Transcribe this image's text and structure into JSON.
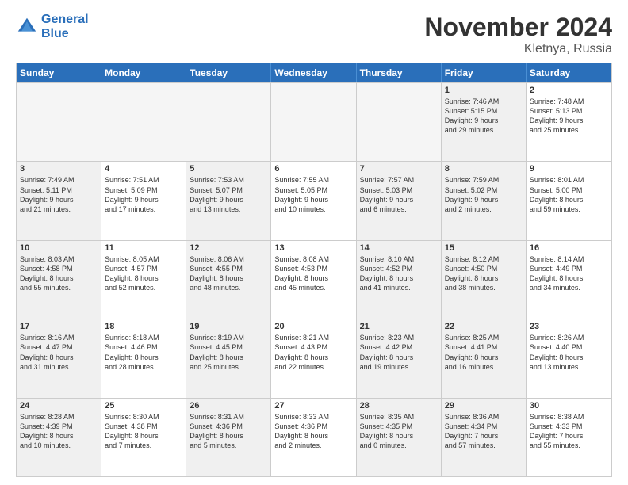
{
  "logo": {
    "line1": "General",
    "line2": "Blue"
  },
  "header": {
    "month": "November 2024",
    "location": "Kletnya, Russia"
  },
  "dayHeaders": [
    "Sunday",
    "Monday",
    "Tuesday",
    "Wednesday",
    "Thursday",
    "Friday",
    "Saturday"
  ],
  "weeks": [
    [
      {
        "day": "",
        "text": "",
        "empty": true
      },
      {
        "day": "",
        "text": "",
        "empty": true
      },
      {
        "day": "",
        "text": "",
        "empty": true
      },
      {
        "day": "",
        "text": "",
        "empty": true
      },
      {
        "day": "",
        "text": "",
        "empty": true
      },
      {
        "day": "1",
        "text": "Sunrise: 7:46 AM\nSunset: 5:15 PM\nDaylight: 9 hours\nand 29 minutes.",
        "shaded": true
      },
      {
        "day": "2",
        "text": "Sunrise: 7:48 AM\nSunset: 5:13 PM\nDaylight: 9 hours\nand 25 minutes."
      }
    ],
    [
      {
        "day": "3",
        "text": "Sunrise: 7:49 AM\nSunset: 5:11 PM\nDaylight: 9 hours\nand 21 minutes.",
        "shaded": true
      },
      {
        "day": "4",
        "text": "Sunrise: 7:51 AM\nSunset: 5:09 PM\nDaylight: 9 hours\nand 17 minutes."
      },
      {
        "day": "5",
        "text": "Sunrise: 7:53 AM\nSunset: 5:07 PM\nDaylight: 9 hours\nand 13 minutes.",
        "shaded": true
      },
      {
        "day": "6",
        "text": "Sunrise: 7:55 AM\nSunset: 5:05 PM\nDaylight: 9 hours\nand 10 minutes."
      },
      {
        "day": "7",
        "text": "Sunrise: 7:57 AM\nSunset: 5:03 PM\nDaylight: 9 hours\nand 6 minutes.",
        "shaded": true
      },
      {
        "day": "8",
        "text": "Sunrise: 7:59 AM\nSunset: 5:02 PM\nDaylight: 9 hours\nand 2 minutes.",
        "shaded": true
      },
      {
        "day": "9",
        "text": "Sunrise: 8:01 AM\nSunset: 5:00 PM\nDaylight: 8 hours\nand 59 minutes."
      }
    ],
    [
      {
        "day": "10",
        "text": "Sunrise: 8:03 AM\nSunset: 4:58 PM\nDaylight: 8 hours\nand 55 minutes.",
        "shaded": true
      },
      {
        "day": "11",
        "text": "Sunrise: 8:05 AM\nSunset: 4:57 PM\nDaylight: 8 hours\nand 52 minutes."
      },
      {
        "day": "12",
        "text": "Sunrise: 8:06 AM\nSunset: 4:55 PM\nDaylight: 8 hours\nand 48 minutes.",
        "shaded": true
      },
      {
        "day": "13",
        "text": "Sunrise: 8:08 AM\nSunset: 4:53 PM\nDaylight: 8 hours\nand 45 minutes."
      },
      {
        "day": "14",
        "text": "Sunrise: 8:10 AM\nSunset: 4:52 PM\nDaylight: 8 hours\nand 41 minutes.",
        "shaded": true
      },
      {
        "day": "15",
        "text": "Sunrise: 8:12 AM\nSunset: 4:50 PM\nDaylight: 8 hours\nand 38 minutes.",
        "shaded": true
      },
      {
        "day": "16",
        "text": "Sunrise: 8:14 AM\nSunset: 4:49 PM\nDaylight: 8 hours\nand 34 minutes."
      }
    ],
    [
      {
        "day": "17",
        "text": "Sunrise: 8:16 AM\nSunset: 4:47 PM\nDaylight: 8 hours\nand 31 minutes.",
        "shaded": true
      },
      {
        "day": "18",
        "text": "Sunrise: 8:18 AM\nSunset: 4:46 PM\nDaylight: 8 hours\nand 28 minutes."
      },
      {
        "day": "19",
        "text": "Sunrise: 8:19 AM\nSunset: 4:45 PM\nDaylight: 8 hours\nand 25 minutes.",
        "shaded": true
      },
      {
        "day": "20",
        "text": "Sunrise: 8:21 AM\nSunset: 4:43 PM\nDaylight: 8 hours\nand 22 minutes."
      },
      {
        "day": "21",
        "text": "Sunrise: 8:23 AM\nSunset: 4:42 PM\nDaylight: 8 hours\nand 19 minutes.",
        "shaded": true
      },
      {
        "day": "22",
        "text": "Sunrise: 8:25 AM\nSunset: 4:41 PM\nDaylight: 8 hours\nand 16 minutes.",
        "shaded": true
      },
      {
        "day": "23",
        "text": "Sunrise: 8:26 AM\nSunset: 4:40 PM\nDaylight: 8 hours\nand 13 minutes."
      }
    ],
    [
      {
        "day": "24",
        "text": "Sunrise: 8:28 AM\nSunset: 4:39 PM\nDaylight: 8 hours\nand 10 minutes.",
        "shaded": true
      },
      {
        "day": "25",
        "text": "Sunrise: 8:30 AM\nSunset: 4:38 PM\nDaylight: 8 hours\nand 7 minutes."
      },
      {
        "day": "26",
        "text": "Sunrise: 8:31 AM\nSunset: 4:36 PM\nDaylight: 8 hours\nand 5 minutes.",
        "shaded": true
      },
      {
        "day": "27",
        "text": "Sunrise: 8:33 AM\nSunset: 4:36 PM\nDaylight: 8 hours\nand 2 minutes."
      },
      {
        "day": "28",
        "text": "Sunrise: 8:35 AM\nSunset: 4:35 PM\nDaylight: 8 hours\nand 0 minutes.",
        "shaded": true
      },
      {
        "day": "29",
        "text": "Sunrise: 8:36 AM\nSunset: 4:34 PM\nDaylight: 7 hours\nand 57 minutes.",
        "shaded": true
      },
      {
        "day": "30",
        "text": "Sunrise: 8:38 AM\nSunset: 4:33 PM\nDaylight: 7 hours\nand 55 minutes."
      }
    ]
  ]
}
